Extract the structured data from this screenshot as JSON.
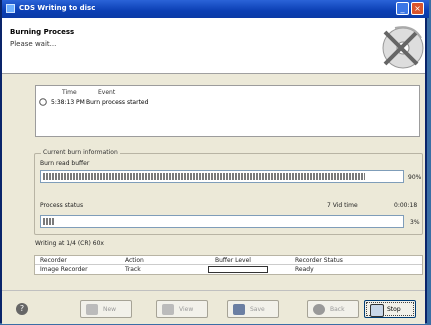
{
  "window": {
    "title": "CDS Writing to disc",
    "minimize_glyph": "_",
    "close_glyph": "×"
  },
  "header": {
    "heading": "Burning Process",
    "subheading": "Please wait..."
  },
  "log": {
    "col_time": "Time",
    "col_event": "Event",
    "entries": [
      {
        "time": "5:38:13 PM",
        "event": "Burn process started"
      }
    ]
  },
  "current_info": {
    "legend": "Current burn information",
    "read_buffer_label": "Burn read buffer",
    "read_buffer_percent_text": "90%",
    "read_buffer_fraction": 0.9,
    "process_status_label": "Process status",
    "time_label": "7 Vid time",
    "time_value": "0:00:18",
    "process_percent_text": "3%",
    "process_fraction": 0.03,
    "writing_status": "Writing at 1/4 (CR) 60x"
  },
  "recorder_table": {
    "headers": [
      "Recorder",
      "Action",
      "Buffer Level",
      "Recorder Status"
    ],
    "rows": [
      {
        "recorder": "Image Recorder",
        "action": "Track",
        "status": "Ready"
      }
    ]
  },
  "footer": {
    "new_label": "New",
    "view_label": "View",
    "save_label": "Save",
    "back_label": "Back",
    "stop_label": "Stop"
  },
  "colors": {
    "titlebar": "#0b3fb4",
    "window_bg": "#ece9d8",
    "progress_segment": "#7a7a7a"
  }
}
